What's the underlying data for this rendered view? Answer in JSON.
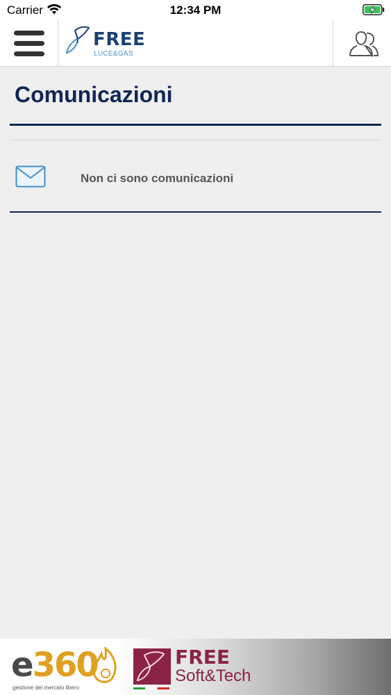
{
  "status_bar": {
    "carrier": "Carrier",
    "time": "12:34 PM",
    "wifi_icon": "wifi-icon",
    "battery_icon": "battery-charging-icon"
  },
  "nav": {
    "menu_icon": "hamburger-menu-icon",
    "logo": {
      "word": "FREE",
      "sub": "LUCE&GAS"
    },
    "profile_icon": "users-icon"
  },
  "page": {
    "title": "Comunicazioni"
  },
  "messages": {
    "icon": "envelope-icon",
    "empty_text": "Non ci sono comunicazioni"
  },
  "footer": {
    "e360": {
      "word_e": "e",
      "word_num": "360",
      "tagline": "gestione del mercato libero"
    },
    "free_softtech": {
      "word": "FREE",
      "sub": "Soft&Tech"
    }
  },
  "colors": {
    "brand_navy": "#0f2656",
    "brand_blue": "#1b3f72",
    "light_blue": "#4a90c8",
    "background": "#efeff0",
    "free_softtech": "#8c2346",
    "e360_gold": "#e0a020"
  }
}
